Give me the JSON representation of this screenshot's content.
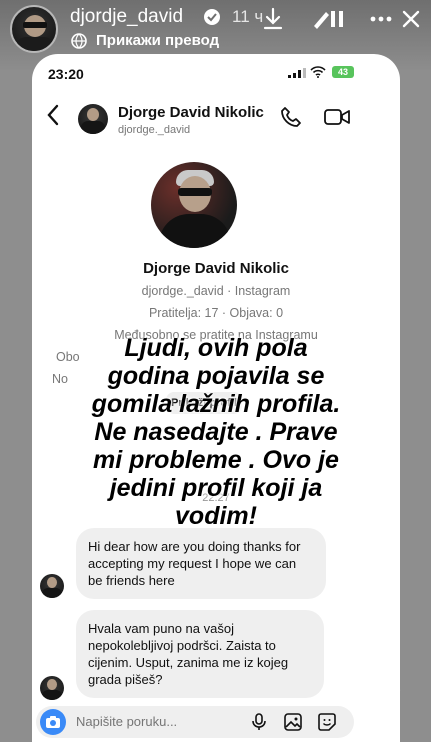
{
  "story": {
    "username": "djordje_david",
    "time": "11 ч",
    "translate_label": "Прикажи превод"
  },
  "status_bar": {
    "time": "23:20",
    "battery": "43"
  },
  "chat": {
    "name": "Djorge David Nikolic",
    "handle": "djordge._david"
  },
  "profile": {
    "name": "Djorge David Nikolic",
    "handle_line": "djordge._david · Instagram",
    "stats_line": "Pratitelja: 17 · Objava: 0",
    "mutual_line": "Međusobno se pratite na Instagramu",
    "partial_line_1": "Obo",
    "partial_line_2": "No",
    "view_profile": "Prikaži profil"
  },
  "overlay_text": [
    "Ljudi, ovih  pola",
    "godina pojavila se",
    "gomila lažnih profila.",
    "Ne nasedajte . Prave",
    "mi probleme . Ovo je",
    "jedini profil koji ja",
    "vodim!"
  ],
  "chat_time": "22:27",
  "messages": [
    {
      "text": "Hi dear how are you doing thanks for accepting my request I hope we can be friends here"
    },
    {
      "text": "Hvala vam puno na vašoj nepokolebljivoj podršci. Zaista to cijenim. Usput, zanima me iz kojeg grada pišeš?"
    }
  ],
  "composer": {
    "placeholder": "Napišite poruku..."
  }
}
